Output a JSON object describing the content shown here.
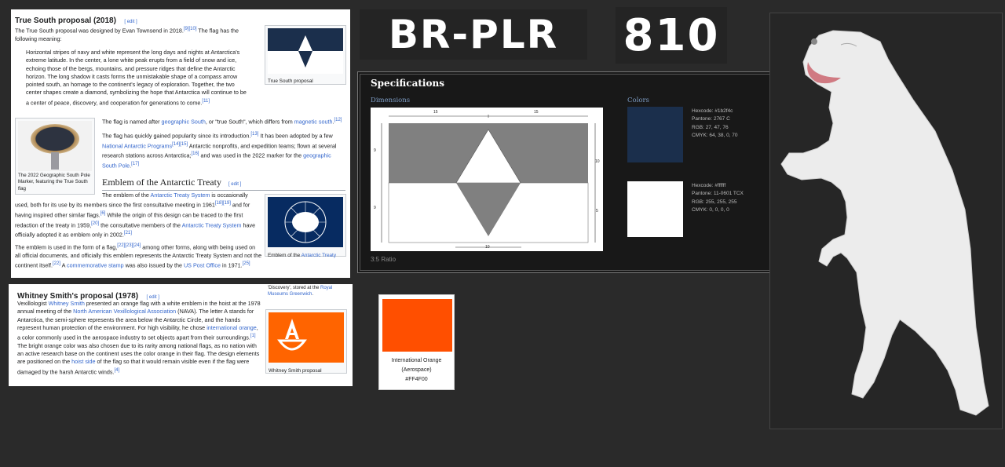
{
  "true_south": {
    "heading": "True South proposal (2018)",
    "edit": "[ edit ]",
    "p1a": "The True South proposal was designed by Evan Townsend in 2018.",
    "p1s": "[9][10]",
    "p1b": " The flag has the following meaning:",
    "quote": "Horizontal stripes of navy and white represent the long days and nights at Antarctica's extreme latitude. In the center, a lone white peak erupts from a field of snow and ice, echoing those of the bergs, mountains, and pressure ridges that define the Antarctic horizon. The long shadow it casts forms the unmistakable shape of a compass arrow pointed south, an homage to the continent's legacy of exploration. Together, the two center shapes create a diamond, symbolizing the hope that Antarctica will continue to be a center of peace, discovery, and cooperation for generations to come.",
    "quote_sup": "[11]",
    "flag_caption": "True South proposal",
    "marker_caption": "The 2022 Geographic South Pole Marker, featuring the True South flag",
    "p2a": "The flag is named after ",
    "p2l1": "geographic South",
    "p2b": ", or \"true South\", which differs from ",
    "p2l2": "magnetic south",
    "p2s": "[12]",
    "p3a": "The flag has quickly gained popularity since its introduction.",
    "p3s1": "[13]",
    "p3b": " It has been adopted by a few ",
    "p3l1": "National Antarctic Programs",
    "p3s2": "[14][15]",
    "p3c": " Antarctic nonprofits, and expedition teams; flown at several research stations across Antarctica;",
    "p3s3": "[16]",
    "p3d": " and was used in the 2022 marker for the ",
    "p3l2": "geographic South Pole",
    "p3s4": "[17]"
  },
  "emblem": {
    "heading": "Emblem of the Antarctic Treaty",
    "edit": "[ edit ]",
    "p1a": "The emblem of the ",
    "p1l1": "Antarctic Treaty System",
    "p1b": " is occasionally used, both for its use by its members since the first consultative meeting in 1961",
    "p1s1": "[18][19]",
    "p1c": " and for having inspired other similar flags.",
    "p1s2": "[6]",
    "p1d": " While the origin of this design can be traced to the first redaction of the treaty in 1959,",
    "p1s3": "[20]",
    "p1e": " the consultative members of the ",
    "p1l2": "Antarctic Treaty System",
    "p1f": " have officially adopted it as emblem only in 2002.",
    "p1s4": "[21]",
    "p2a": "The emblem is used in the form of a flag,",
    "p2s1": "[22][23][24]",
    "p2b": " among other forms, along with being used on all official documents, and officially this emblem represents the Antarctic Treaty System and not the continent itself.",
    "p2s2": "[22]",
    "p2c": " A ",
    "p2l1": "commemorative stamp",
    "p2d": " was also issued by the ",
    "p2l2": "US Post Office",
    "p2e": " in 1971.",
    "p2s3": "[25]",
    "flag_caption_a": "Emblem of the ",
    "flag_caption_l": "Antarctic Treaty"
  },
  "whitney": {
    "heading": "Whitney Smith's proposal (1978)",
    "edit": "[ edit ]",
    "top_caption_a": "'Discovery', stored at the ",
    "top_caption_l": "Royal Museums Greenwich",
    "pa": "Vexillologist ",
    "pl1": "Whitney Smith",
    "pb": " presented an orange flag with a white emblem in the hoist at the 1978 annual meeting of the ",
    "pl2": "North American Vexillological Association",
    "pc": " (NAVA). The letter A stands for Antarctica, the semi-sphere represents the area below the Antarctic Circle, and the hands represent human protection of the environment. For high visibility, he chose ",
    "pl3": "international orange",
    "pd": ", a color commonly used in the aerospace industry to set objects apart from their surroundings.",
    "ps1": "[1]",
    "pe": " The bright orange color was also chosen due to its rarity among national flags, as no nation with an active research base on the continent uses the color orange in their flag. The design elements are positioned on the ",
    "pl4": "hoist side",
    "pf": " of the flag so that it would remain visible even if the flag were damaged by the harsh Antarctic winds.",
    "ps2": "[4]",
    "flag_caption": "Whitney Smith proposal"
  },
  "titles": {
    "left": "BR-PLR",
    "right": "810"
  },
  "specs": {
    "title": "Specifications",
    "dimensions_label": "Dimensions",
    "colors_label": "Colors",
    "ratio": "3:5 Ratio",
    "dims": {
      "top_left": "15",
      "top_right": "15",
      "left_top": "9",
      "left_bottom": "9",
      "right_top": "10",
      "right_bottom": "5",
      "bottom": "10"
    },
    "navy": {
      "hex": "Hexcode: #1b2f4c",
      "pantone": "Pantone: 2767 C",
      "rgb": "RGB: 27, 47, 76",
      "cmyk": "CMYK: 64, 38, 0, 70",
      "swatch": "#1b2f4c"
    },
    "white": {
      "hex": "Hexcode: #ffffff",
      "pantone": "Pantone: 11-0601 TCX",
      "rgb": "RGB: 255, 255, 255",
      "cmyk": "CMYK: 0, 0, 0, 0",
      "swatch": "#ffffff"
    }
  },
  "orange_card": {
    "line1": "International Orange",
    "line2": "(Aerospace)",
    "line3": "#FF4F00",
    "swatch": "#ff4f00"
  }
}
